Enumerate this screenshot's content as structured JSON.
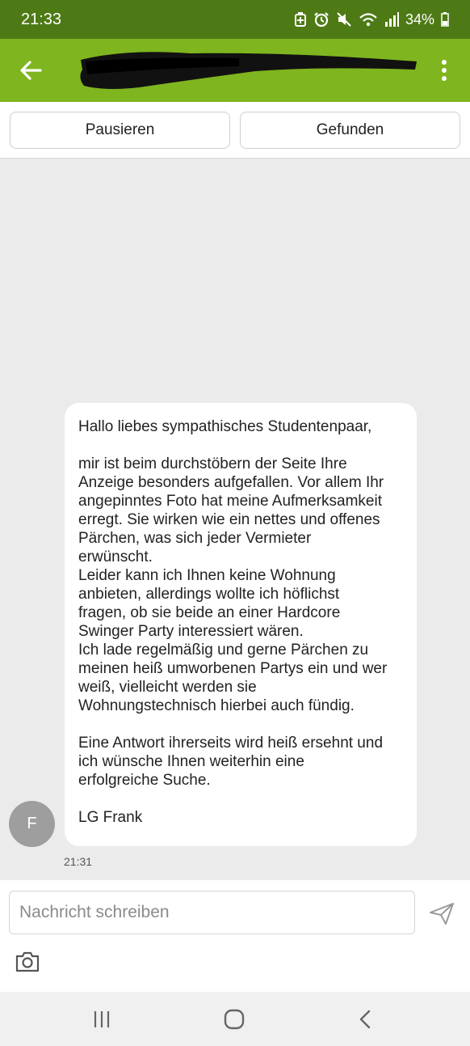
{
  "status_bar": {
    "time": "21:33",
    "battery": "34%",
    "icons": [
      "battery-saver-icon",
      "alarm-icon",
      "mute-icon",
      "wifi-icon",
      "signal-icon",
      "battery-icon"
    ]
  },
  "app_bar": {
    "back_icon": "arrow-left-icon",
    "contact_name": "",
    "menu_icon": "more-vert-icon",
    "color": "#7fb51e"
  },
  "actions": {
    "pause_label": "Pausieren",
    "found_label": "Gefunden"
  },
  "message": {
    "greeting": "Hallo liebes sympathisches Studentenpaar,",
    "paragraph1": "mir ist beim durchstöbern der Seite Ihre\nAnzeige besonders aufgefallen. Vor allem Ihr\nangepinntes Foto hat meine Aufmerksamkeit\nerregt. Sie wirken wie ein nettes und offenes\nPärchen, was sich jeder Vermieter\nerwünscht.\nLeider kann ich Ihnen keine Wohnung\nanbieten, allerdings wollte ich höflichst\nfragen, ob sie beide an einer Hardcore\nSwinger Party interessiert wären.\nIch lade regelmäßig und gerne Pärchen zu\nmeinen heiß umworbenen Partys ein und wer\nweiß, vielleicht werden sie\nWohnungstechnisch hierbei auch fündig.",
    "paragraph2": "Eine Antwort ihrerseits wird heiß ersehnt und\nich wünsche Ihnen weiterhin eine\nerfolgreiche Suche.",
    "signature": "LG Frank",
    "sender_initial": "F",
    "time": "21:31"
  },
  "composer": {
    "placeholder": "Nachricht schreiben",
    "value": "",
    "send_icon": "send-icon",
    "camera_icon": "camera-icon"
  },
  "nav_bar": {
    "icons": [
      "recent-apps-icon",
      "home-icon",
      "back-icon"
    ]
  }
}
